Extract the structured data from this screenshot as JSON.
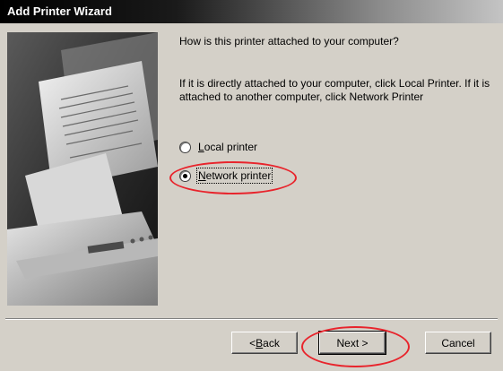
{
  "window": {
    "title": "Add Printer Wizard"
  },
  "wizard": {
    "question": "How is this printer attached to your computer?",
    "instructions": "If it is directly attached to your computer, click Local Printer. If it is attached to another computer, click Network Printer",
    "options": [
      {
        "mnemonic": "L",
        "rest": "ocal printer",
        "checked": false
      },
      {
        "mnemonic": "N",
        "rest": "etwork printer",
        "checked": true
      }
    ]
  },
  "buttons": {
    "back_prefix": "< ",
    "back_mnemonic": "B",
    "back_rest": "ack",
    "next_label": "Next >",
    "cancel_label": "Cancel"
  },
  "annotations": {
    "color": "#e8242c"
  }
}
